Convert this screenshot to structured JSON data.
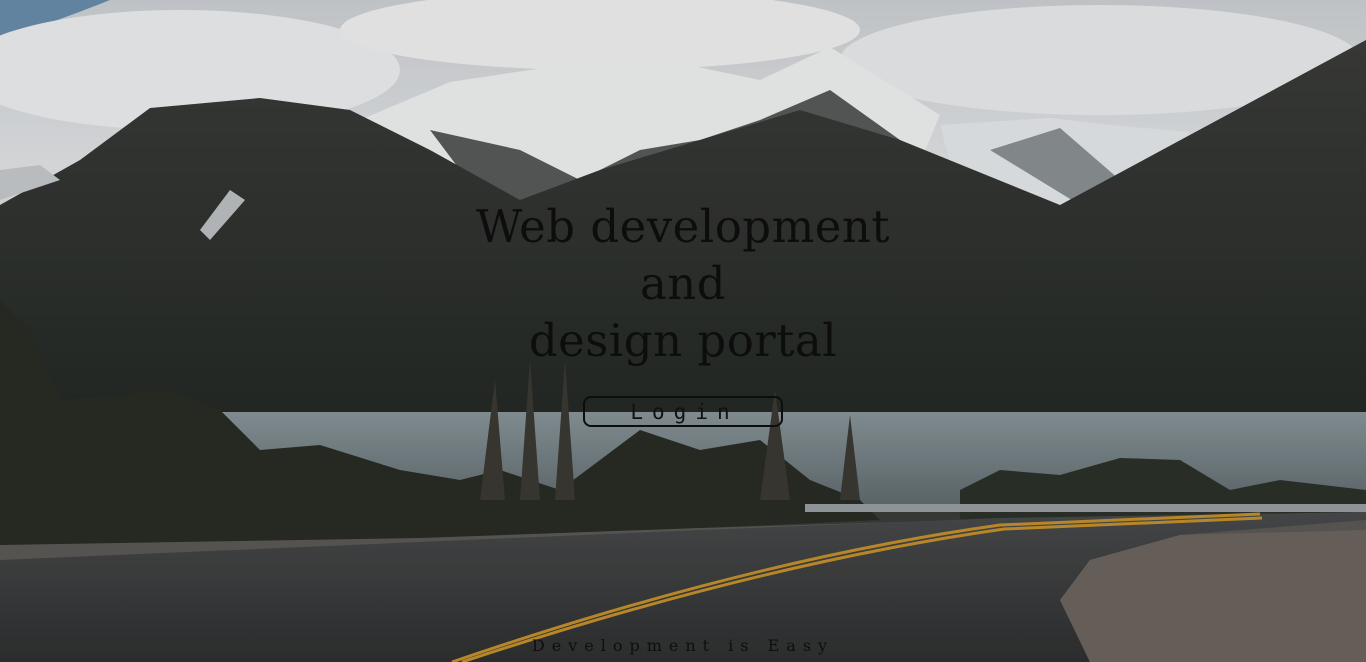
{
  "hero": {
    "headline_lines": [
      "Web development",
      "and",
      "design portal"
    ],
    "login_label": "Login",
    "tagline": "Development is Easy",
    "background_icon": "mountain-road-landscape"
  },
  "colors": {
    "text": "#0d0d0d",
    "sky": "#d9dcdf",
    "mountain": "#2e302e",
    "lake": "#7d8a8f",
    "road": "#3b3c3d",
    "road_line": "#c7922d"
  }
}
